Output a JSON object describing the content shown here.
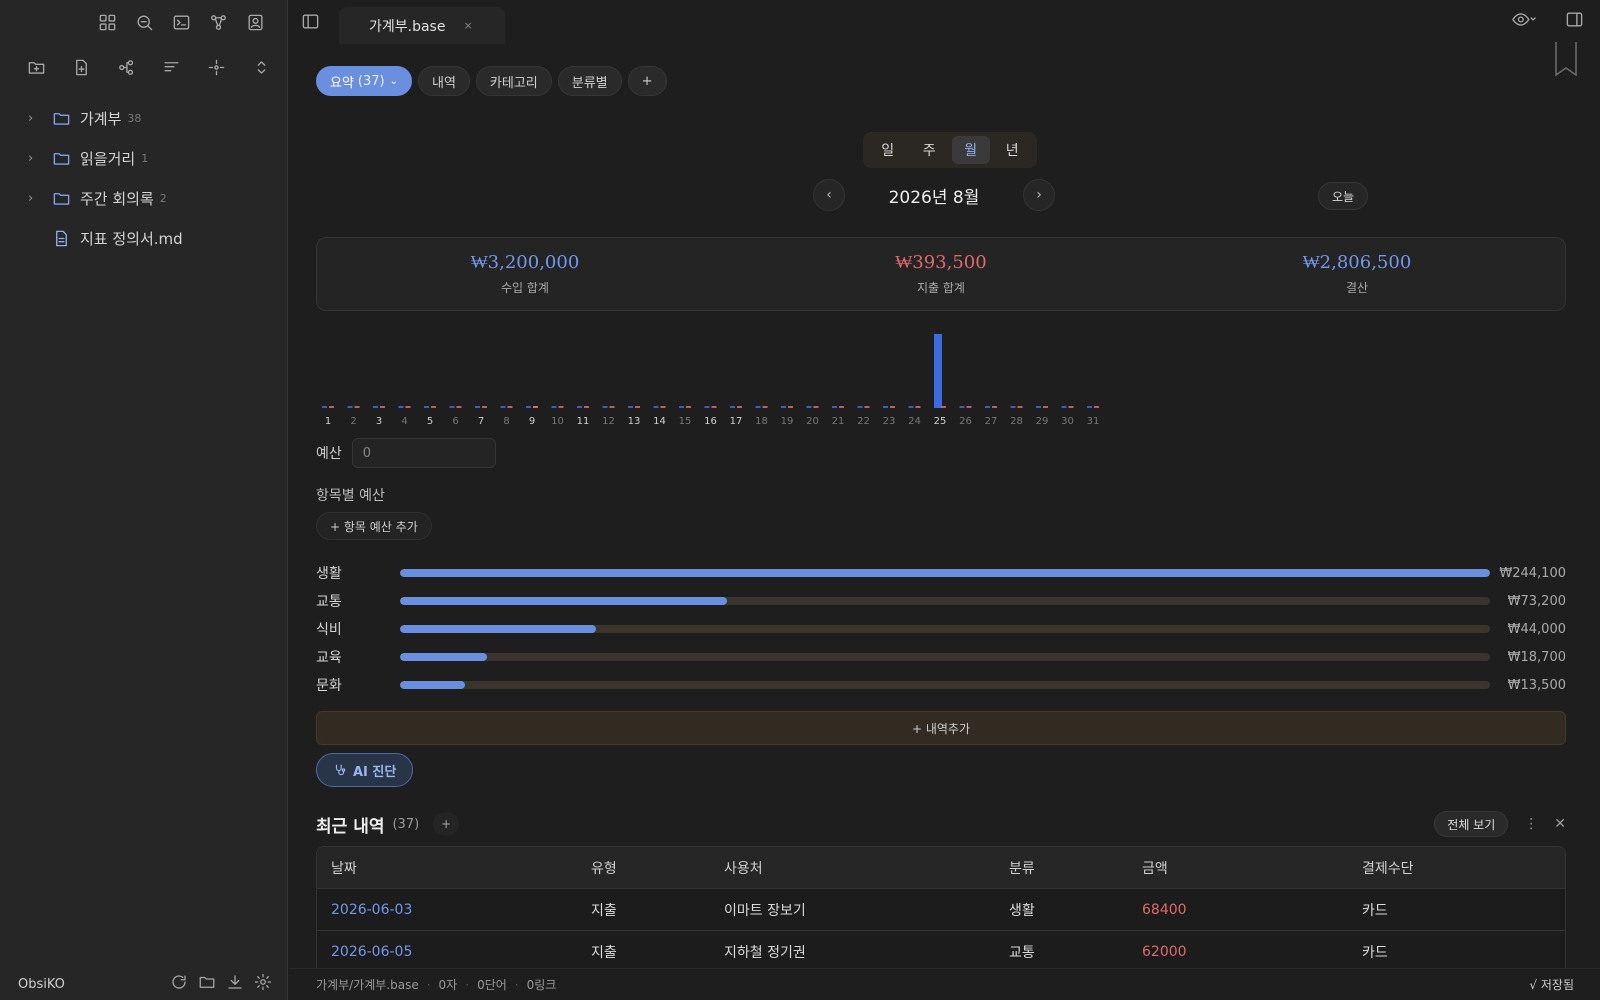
{
  "sidebar": {
    "top_icons": [
      "layout-grid-icon",
      "search-zoom-icon",
      "terminal-icon",
      "graph-icon",
      "contacts-icon"
    ],
    "tool_icons": [
      "new-folder-icon",
      "new-file-icon",
      "graph-nodes-icon",
      "sort-icon",
      "focus-icon",
      "collapse-icon"
    ],
    "tree": [
      {
        "label": "가계부",
        "count": "38",
        "type": "folder"
      },
      {
        "label": "읽을거리",
        "count": "1",
        "type": "folder"
      },
      {
        "label": "주간 회의록",
        "count": "2",
        "type": "folder"
      },
      {
        "label": "지표 정의서.md",
        "count": "",
        "type": "file"
      }
    ],
    "vault_name": "ObsiKO"
  },
  "tab": {
    "title": "가계부.base",
    "close": "×"
  },
  "views": {
    "active_label": "요약",
    "active_count": "(37)",
    "active_caret": "⌄",
    "others": [
      "내역",
      "카테고리",
      "분류별"
    ],
    "add": "+"
  },
  "period": {
    "options": [
      "일",
      "주",
      "월",
      "년"
    ],
    "selected": "월"
  },
  "nav": {
    "prev": "‹",
    "month": "2026년 8월",
    "next": "›",
    "today": "오늘"
  },
  "summary": {
    "income_value": "₩3,200,000",
    "income_label": "수입 합계",
    "expense_value": "₩393,500",
    "expense_label": "지출 합계",
    "balance_value": "₩2,806,500",
    "balance_label": "결산"
  },
  "chart_data": {
    "type": "bar",
    "categories": [
      "1",
      "2",
      "3",
      "4",
      "5",
      "6",
      "7",
      "8",
      "9",
      "10",
      "11",
      "12",
      "13",
      "14",
      "15",
      "16",
      "17",
      "18",
      "19",
      "20",
      "21",
      "22",
      "23",
      "24",
      "25",
      "26",
      "27",
      "28",
      "29",
      "30",
      "31"
    ],
    "bold_days": [
      "1",
      "3",
      "5",
      "7",
      "9",
      "11",
      "13",
      "14",
      "16",
      "17",
      "25"
    ],
    "series": [
      {
        "color": "#3d6be0",
        "values": [
          0,
          0,
          0,
          0,
          0,
          0,
          0,
          0,
          0,
          0,
          0,
          0,
          0,
          0,
          0,
          0,
          0,
          0,
          0,
          0,
          0,
          0,
          0,
          0,
          3200000,
          0,
          0,
          0,
          0,
          0,
          0
        ]
      },
      {
        "color": "#e06a6a",
        "values": [
          0,
          0,
          0,
          0,
          0,
          0,
          0,
          0,
          12000,
          0,
          0,
          0,
          0,
          0,
          0,
          0,
          0,
          0,
          0,
          0,
          0,
          0,
          0,
          0,
          0,
          0,
          0,
          0,
          0,
          0,
          0
        ]
      }
    ]
  },
  "budget": {
    "label": "예산",
    "value": "0"
  },
  "category_budget": {
    "title": "항목별 예산",
    "add_label": "+ 항목 예산 추가"
  },
  "category_bars": [
    {
      "name": "생활",
      "amount": "₩244,100",
      "ratio": 1.0
    },
    {
      "name": "교통",
      "amount": "₩73,200",
      "ratio": 0.3
    },
    {
      "name": "식비",
      "amount": "₩44,000",
      "ratio": 0.18
    },
    {
      "name": "교육",
      "amount": "₩18,700",
      "ratio": 0.08
    },
    {
      "name": "문화",
      "amount": "₩13,500",
      "ratio": 0.06
    }
  ],
  "add_entry": "+ 내역추가",
  "ai_button": "AI 진단",
  "recent": {
    "title": "최근 내역",
    "count": "(37)",
    "add": "+",
    "view_all": "전체 보기",
    "more": "⋮",
    "close": "✕"
  },
  "table": {
    "headers": [
      "날짜",
      "유형",
      "사용처",
      "분류",
      "금액",
      "결제수단"
    ],
    "rows": [
      [
        "2026-06-03",
        "지출",
        "이마트 장보기",
        "생활",
        "68400",
        "카드"
      ],
      [
        "2026-06-05",
        "지출",
        "지하철 정기권",
        "교통",
        "62000",
        "카드"
      ]
    ]
  },
  "status": {
    "path": "가계부/가계부.base",
    "chars": "0자",
    "words": "0단어",
    "links": "0링크",
    "saved": "√ 저장됨"
  },
  "colors": {
    "accent": "#6a8fde",
    "income": "#7398ea",
    "expense": "#e06a6a",
    "bg": "#1e1e1e",
    "sidebar_bg": "#262626"
  }
}
